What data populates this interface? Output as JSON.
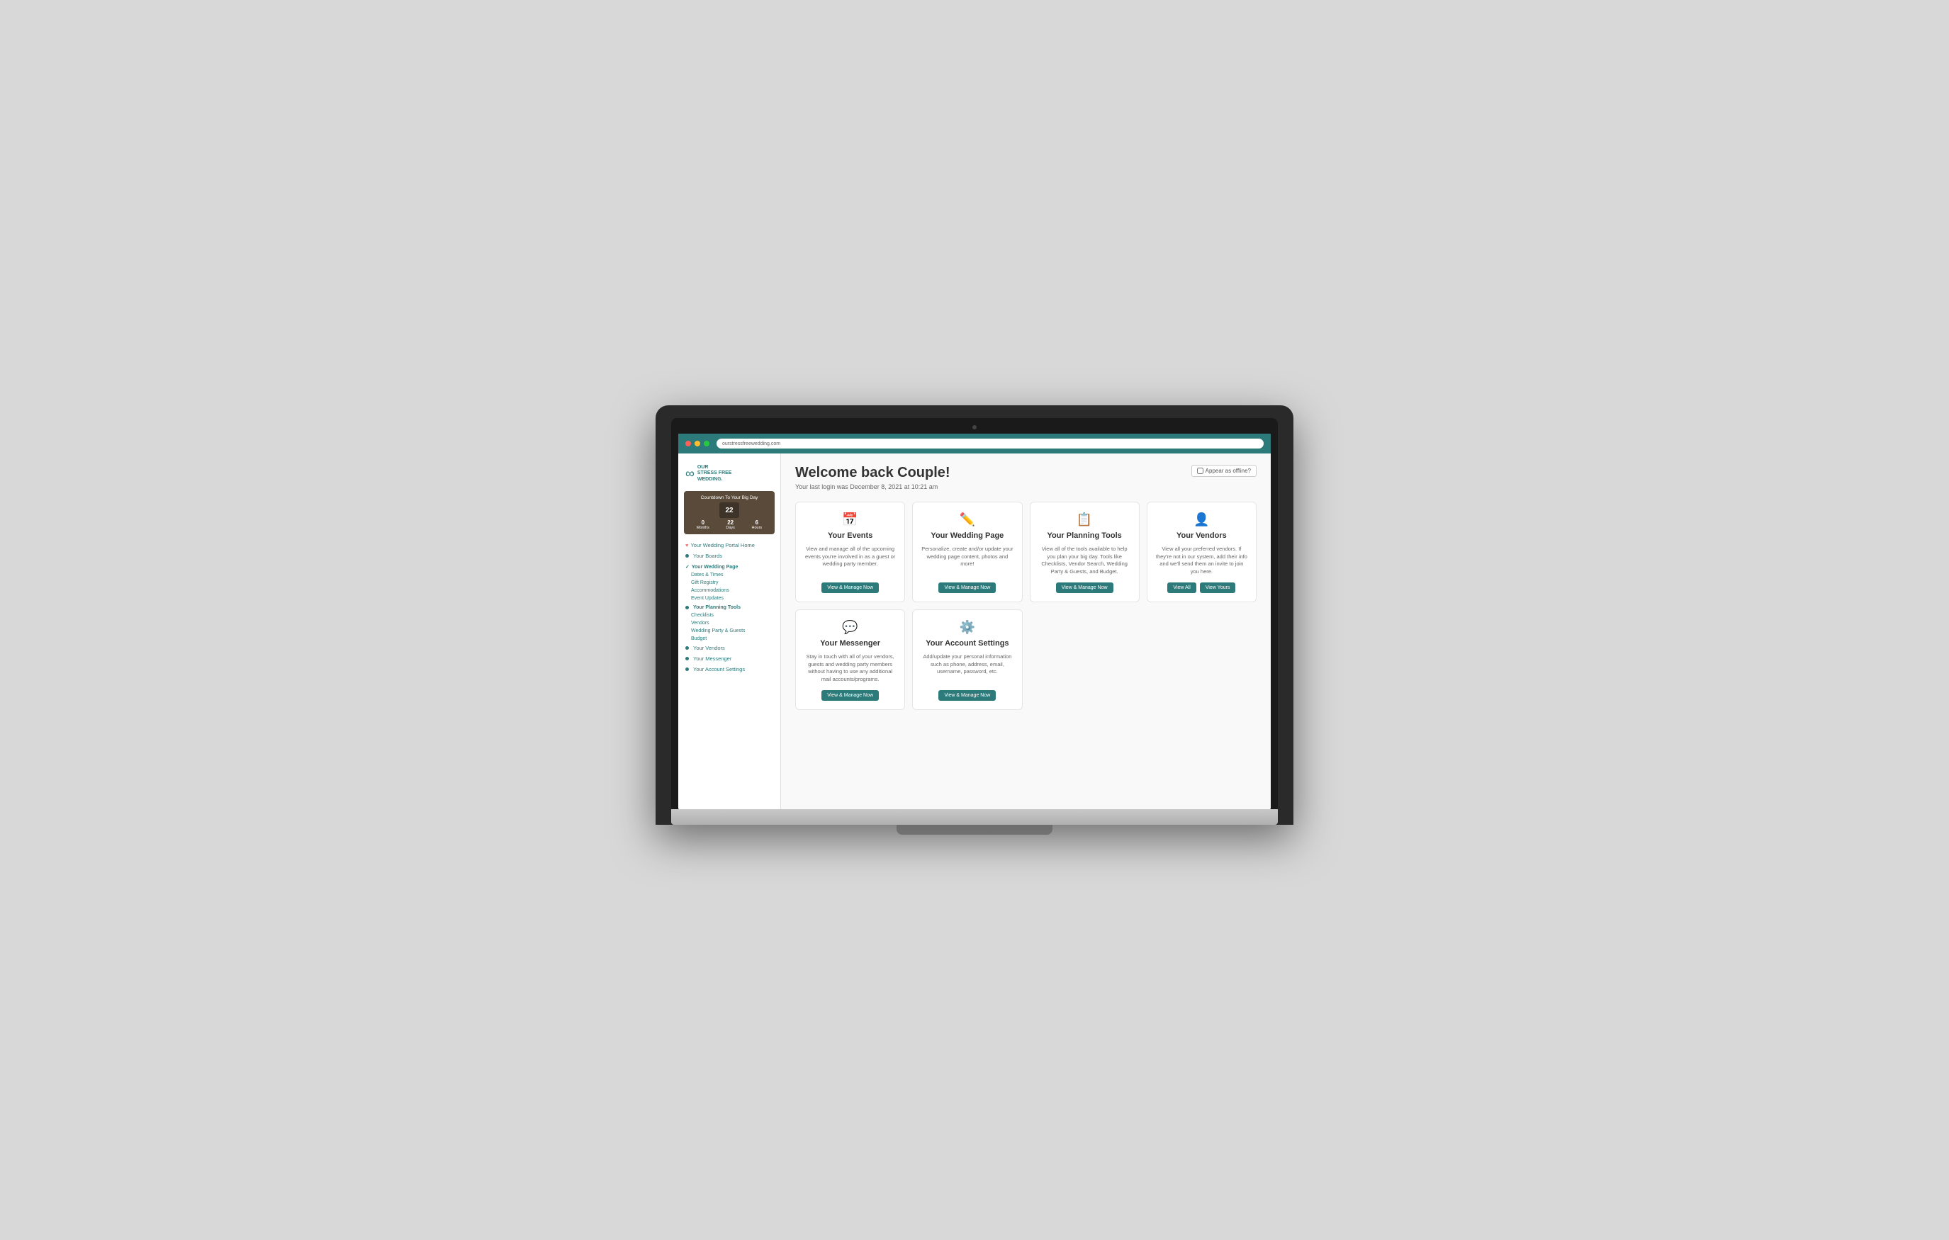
{
  "browser": {
    "url": "ourstressfreewedding.com"
  },
  "logo": {
    "symbol": "∞",
    "line1": "OUR",
    "line2": "STRESS FREE",
    "line3": "WEDDING."
  },
  "countdown": {
    "title": "Countdown To Your Big Day",
    "months_val": "0",
    "months_label": "Months",
    "days_val": "22",
    "days_label": "Days",
    "hours_val": "6",
    "hours_label": "Hours"
  },
  "sidebar": {
    "home_label": "Your Wedding Portal Home",
    "boards_label": "Your Boards",
    "wedding_page_header": "Your Wedding Page",
    "sub_items": [
      "Dates & Times",
      "Gift Registry",
      "Accommodations",
      "Event Updates"
    ],
    "planning_header": "Your Planning Tools",
    "planning_sub": [
      "Checklists",
      "Vendors",
      "Wedding Party & Guests",
      "Budget"
    ],
    "vendors_label": "Your Vendors",
    "messenger_label": "Your Messenger",
    "account_label": "Your Account Settings"
  },
  "header": {
    "welcome": "Welcome back Couple!",
    "last_login": "Your last login was December 8, 2021 at 10:21 am",
    "offline_label": "Appear as offline?"
  },
  "cards": [
    {
      "id": "events",
      "icon": "📅",
      "title": "Your Events",
      "desc": "View and manage all of the upcoming events you're involved in as a guest or wedding party member.",
      "buttons": [
        {
          "label": "View & Manage Now",
          "type": "primary"
        }
      ]
    },
    {
      "id": "wedding-page",
      "icon": "✏️",
      "title": "Your Wedding Page",
      "desc": "Personalize, create and/or update your wedding page content, photos and more!",
      "buttons": [
        {
          "label": "View & Manage Now",
          "type": "primary"
        }
      ]
    },
    {
      "id": "planning",
      "icon": "📋",
      "title": "Your Planning Tools",
      "desc": "View all of the tools available to help you plan your big day. Tools like Checklists, Vendor Search, Wedding Party & Guests, and Budget.",
      "buttons": [
        {
          "label": "View & Manage Now",
          "type": "primary"
        }
      ]
    },
    {
      "id": "vendors",
      "icon": "👤",
      "title": "Your Vendors",
      "desc": "View all your preferred vendors. If they're not in our system, add their info and we'll send them an invite to join you here.",
      "buttons": [
        {
          "label": "View All",
          "type": "primary"
        },
        {
          "label": "View Yours",
          "type": "primary"
        }
      ]
    },
    {
      "id": "messenger",
      "icon": "💬",
      "title": "Your Messenger",
      "desc": "Stay in touch with all of your vendors, guests and wedding party members without having to use any additional mail accounts/programs.",
      "buttons": [
        {
          "label": "View & Manage Now",
          "type": "primary"
        }
      ]
    },
    {
      "id": "account",
      "icon": "⚙️",
      "title": "Your Account Settings",
      "desc": "Add/update your personal information such as phone, address, email, username, password, etc.",
      "buttons": [
        {
          "label": "View & Manage Now",
          "type": "primary"
        }
      ]
    }
  ]
}
